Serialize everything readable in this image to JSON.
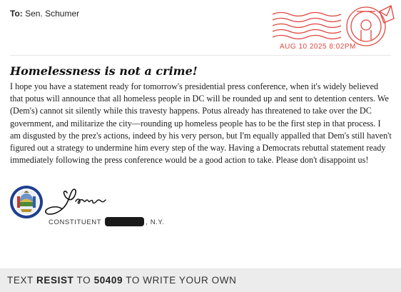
{
  "header": {
    "to_label": "To:",
    "recipient": "Sen. Schumer"
  },
  "postmark": {
    "date_time": "AUG 10 2025 8:02PM",
    "color": "#e0463f",
    "icon": "postmark-cancellation-icon"
  },
  "letter": {
    "title": "Homelessness is not a crime!",
    "body": "I hope you have a statement ready for tomorrow's presidential press conference, when it's widely believed that potus will announce that all homeless people in DC will be rounded up and sent to detention centers. We (Dem's) cannot sit silently while this travesty happens. Potus already has threatened to take over the DC government, and militarize the city—rounding up homeless people has to be the first step in that process. I am disgusted by the prez's actions, indeed by his very person, but I'm equally appalled that Dem's still haven't figured out a strategy to undermine him every step of the way. Having a Democrats rebuttal statement ready immediately following the press conference would be a good action to take. Please don't disappoint us!"
  },
  "signature": {
    "name": "Yvonne",
    "seal_icon": "new-york-state-seal-icon",
    "constituent_label": "CONSTITUENT",
    "state_suffix": ", N.Y."
  },
  "footer": {
    "text_prefix": "TEXT",
    "keyword": "RESIST",
    "text_middle": "TO",
    "number": "50409",
    "text_suffix": "TO WRITE YOUR OWN"
  }
}
